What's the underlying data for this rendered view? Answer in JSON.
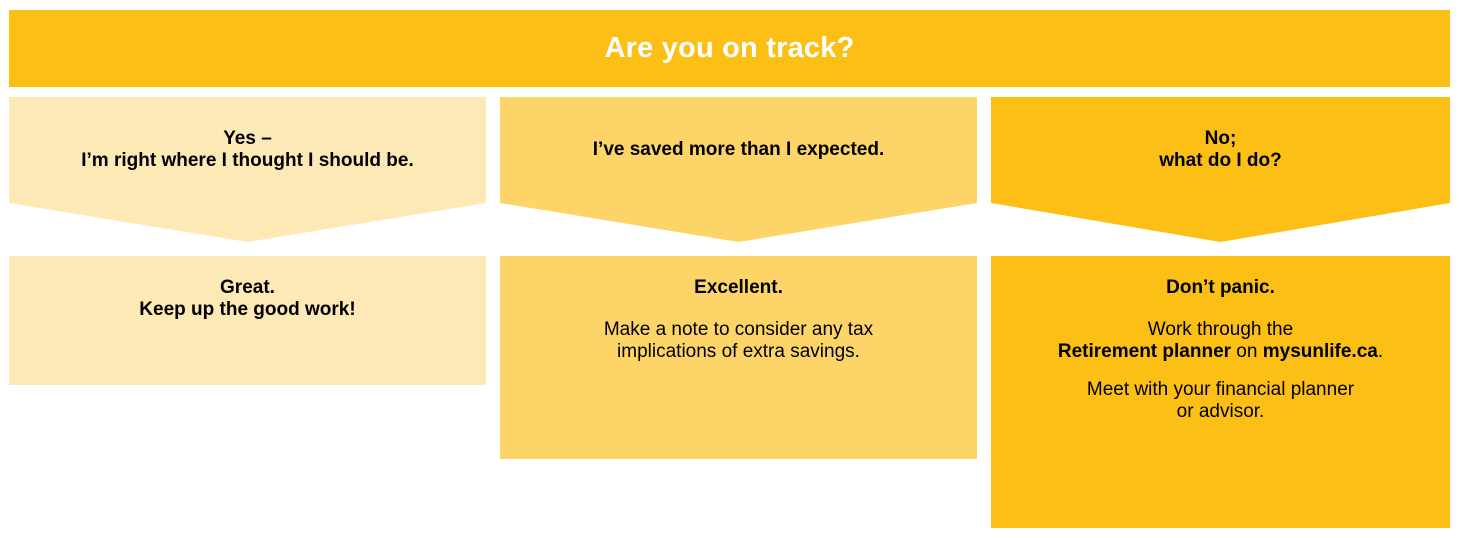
{
  "colors": {
    "header_bg": "#fbbf16",
    "light": "#fde9b6",
    "medium": "#fcd468",
    "dark": "#fbbf16"
  },
  "header": {
    "title": "Are you on track?"
  },
  "columns": [
    {
      "question_line1": "Yes –",
      "question_line2": "I’m right where I thought I should be.",
      "answer_title_line1": "Great.",
      "answer_title_line2": "Keep up the good work!"
    },
    {
      "question_line1": "I’ve saved more than I expected.",
      "answer_title": "Excellent.",
      "answer_body_line1": "Make a note to consider any tax",
      "answer_body_line2": "implications of extra savings."
    },
    {
      "question_line1": "No;",
      "question_line2": "what do I do?",
      "answer_title": "Don’t panic.",
      "answer_p1_line1": "Work through the",
      "answer_p1_bold1": "Retirement planner",
      "answer_p1_mid": " on ",
      "answer_p1_bold2": "mysunlife.ca",
      "answer_p1_end": ".",
      "answer_p2_line1": "Meet with your financial planner",
      "answer_p2_line2": "or advisor."
    }
  ]
}
